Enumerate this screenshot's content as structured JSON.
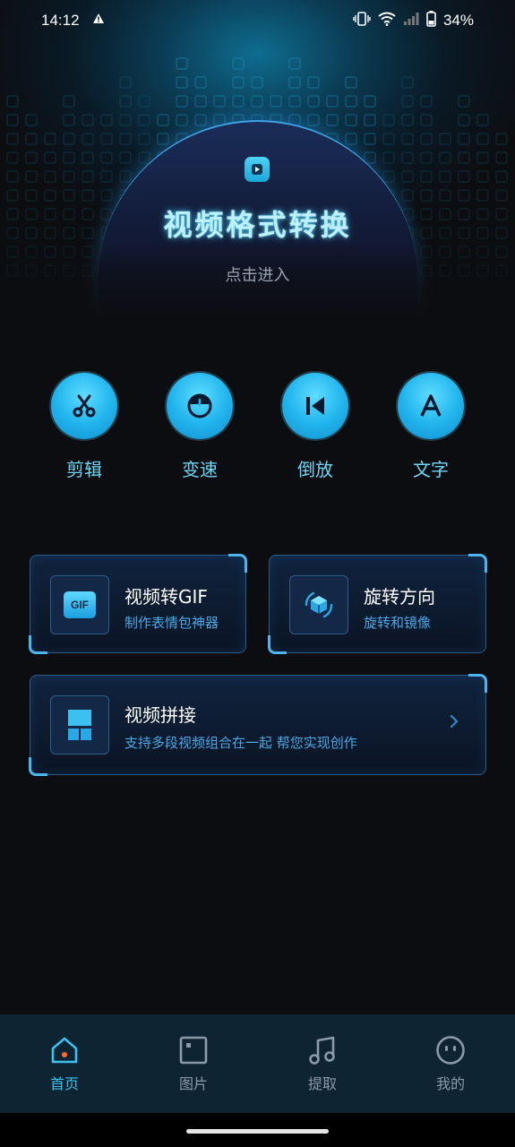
{
  "status_bar": {
    "time": "14:12",
    "battery": "34%"
  },
  "hero": {
    "title": "视频格式转换",
    "subtitle": "点击进入"
  },
  "tools": [
    {
      "label": "剪辑",
      "icon": "scissors-icon"
    },
    {
      "label": "变速",
      "icon": "speedometer-icon"
    },
    {
      "label": "倒放",
      "icon": "rewind-icon"
    },
    {
      "label": "文字",
      "icon": "text-a-icon"
    }
  ],
  "cards": {
    "gif": {
      "title": "视频转GIF",
      "subtitle": "制作表情包神器",
      "icon_text": "GIF",
      "icon": "gif-icon"
    },
    "rotate": {
      "title": "旋转方向",
      "subtitle": "旋转和镜像",
      "icon": "rotate-cube-icon"
    },
    "splice": {
      "title": "视频拼接",
      "subtitle": "支持多段视频组合在一起 帮您实现创作",
      "icon": "grid-splice-icon"
    }
  },
  "bottom_nav": [
    {
      "label": "首页",
      "icon": "home-icon",
      "active": true
    },
    {
      "label": "图片",
      "icon": "image-icon",
      "active": false
    },
    {
      "label": "提取",
      "icon": "music-note-icon",
      "active": false
    },
    {
      "label": "我的",
      "icon": "smiley-icon",
      "active": false
    }
  ],
  "colors": {
    "accent": "#3cc0f0",
    "card_border": "#2a5b86",
    "background": "#0c0d10",
    "nav_background": "#0f2433"
  }
}
